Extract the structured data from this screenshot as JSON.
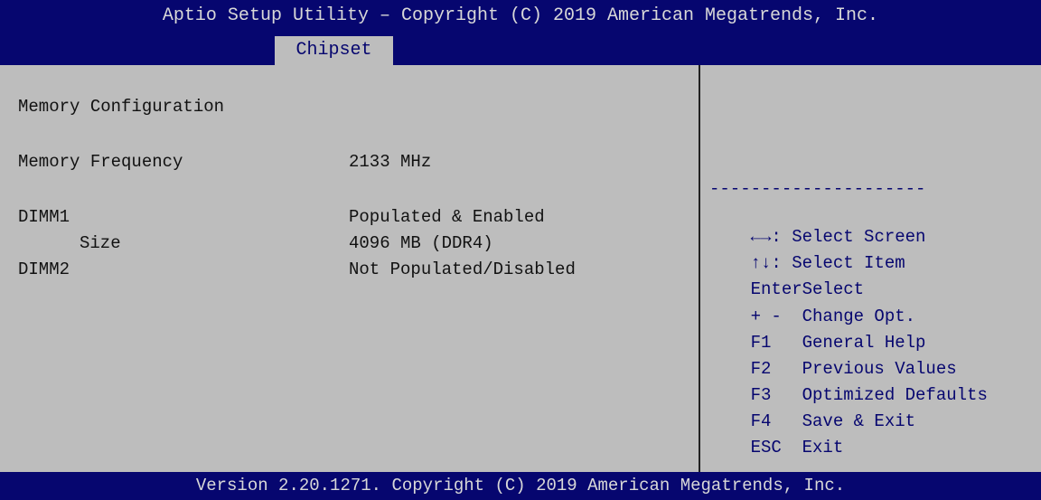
{
  "header": {
    "title": "Aptio Setup Utility – Copyright (C) 2019 American Megatrends, Inc.",
    "active_tab": "Chipset"
  },
  "main": {
    "section_title": "Memory Configuration",
    "rows": [
      {
        "label": "Memory Frequency",
        "value": "2133 MHz"
      },
      {
        "label": "DIMM1",
        "value": "Populated & Enabled"
      },
      {
        "label": "Size",
        "value": "4096 MB (DDR4)"
      },
      {
        "label": "DIMM2",
        "value": "Not Populated/Disabled"
      }
    ]
  },
  "help": {
    "separator": "---------------------",
    "keys": [
      {
        "key": "←→",
        "desc": ": Select Screen"
      },
      {
        "key": "↑↓",
        "desc": ": Select Item"
      },
      {
        "key": "Enter",
        "desc": "Select"
      },
      {
        "key": "+ -",
        "desc": "Change Opt."
      },
      {
        "key": "F1",
        "desc": "General Help"
      },
      {
        "key": "F2",
        "desc": "Previous Values"
      },
      {
        "key": "F3",
        "desc": "Optimized Defaults"
      },
      {
        "key": "F4",
        "desc": "Save & Exit"
      },
      {
        "key": "ESC",
        "desc": "Exit"
      }
    ]
  },
  "footer": {
    "version": "Version 2.20.1271. Copyright (C) 2019 American Megatrends, Inc."
  },
  "colors": {
    "header_bg": "#06066f",
    "panel_bg": "#bdbdbd",
    "header_text": "#d8d8d8",
    "help_text": "#06066f"
  }
}
